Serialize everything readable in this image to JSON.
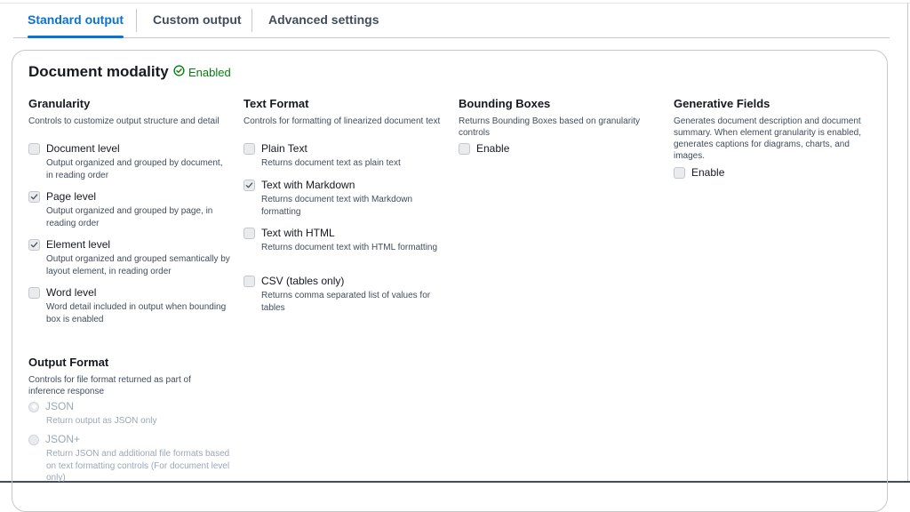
{
  "tabs": [
    {
      "label": "Standard output",
      "active": true
    },
    {
      "label": "Custom output",
      "active": false
    },
    {
      "label": "Advanced settings",
      "active": false
    }
  ],
  "panel": {
    "title": "Document modality",
    "status": "Enabled",
    "status_icon": "check-circle-icon",
    "status_color": "#037f0c"
  },
  "granularity": {
    "title": "Granularity",
    "description": "Controls to customize output structure and detail",
    "options": [
      {
        "label": "Document level",
        "description": "Output organized and grouped by document, in reading order",
        "checked": false
      },
      {
        "label": "Page level",
        "description": "Output organized and grouped by page, in reading order",
        "checked": true
      },
      {
        "label": "Element level",
        "description": "Output organized and grouped semantically by layout element, in reading order",
        "checked": true
      },
      {
        "label": "Word level",
        "description": "Word detail included in output when bounding box is enabled",
        "checked": false
      }
    ]
  },
  "text_format": {
    "title": "Text Format",
    "description": "Controls for formatting of linearized document text",
    "options": [
      {
        "label": "Plain Text",
        "description": "Returns document text as plain text",
        "checked": false
      },
      {
        "label": "Text with Markdown",
        "description": "Returns document text with Markdown formatting",
        "checked": true
      },
      {
        "label": "Text with HTML",
        "description": "Returns document text with HTML formatting",
        "checked": false
      },
      {
        "label": "CSV (tables only)",
        "description": "Returns comma separated list of values for tables",
        "checked": false
      }
    ]
  },
  "bounding_boxes": {
    "title": "Bounding Boxes",
    "description": "Returns Bounding Boxes based on granularity controls",
    "option": {
      "label": "Enable",
      "checked": false
    }
  },
  "generative_fields": {
    "title": "Generative Fields",
    "description": "Generates document description and document summary. When element granularity is enabled, generates captions for diagrams, charts, and images.",
    "option": {
      "label": "Enable",
      "checked": false
    }
  },
  "output_format": {
    "title": "Output Format",
    "description": "Controls for file format returned as part of inference response",
    "options": [
      {
        "label": "JSON",
        "description": "Return output as JSON only",
        "selected": true,
        "disabled": true
      },
      {
        "label": "JSON+",
        "description": "Return JSON and additional file formats based on text formatting controls (For document level only)",
        "selected": false,
        "disabled": true
      }
    ]
  },
  "colors": {
    "accent": "#0972d3",
    "text": "#16191f",
    "muted": "#414d5c",
    "disabled": "#9ba7b6"
  }
}
